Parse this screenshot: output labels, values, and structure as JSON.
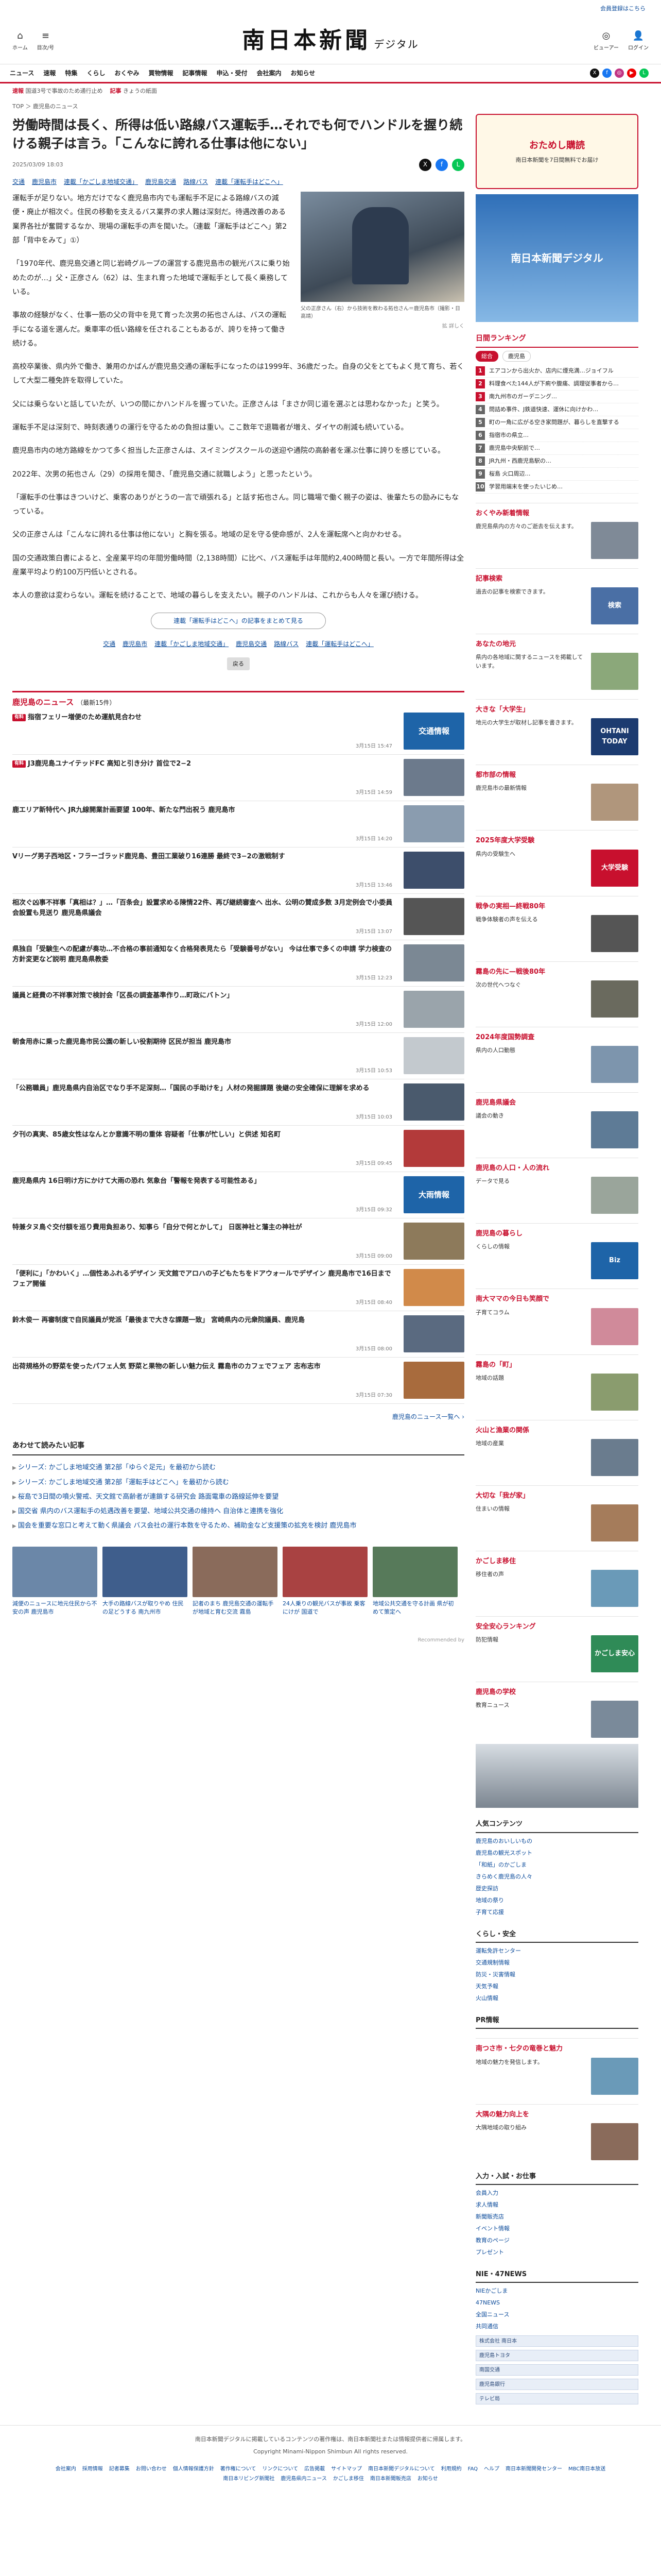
{
  "top": {
    "login": "会員登録はこちら"
  },
  "mast": {
    "left": [
      {
        "sym": "⌂",
        "label": "ホーム"
      },
      {
        "sym": "≡",
        "label": "目次/号"
      }
    ],
    "logo": "南日本新聞",
    "logo_sub": "デジタル",
    "right": [
      {
        "sym": "◎",
        "label": "ビューアー"
      },
      {
        "sym": "👤",
        "label": "ログイン"
      }
    ]
  },
  "nav": [
    "ニュース",
    "速報",
    "特集",
    "くらし",
    "おくやみ",
    "買物情報",
    "記事情報",
    "申込・受付",
    "会社案内",
    "お知らせ"
  ],
  "sns": [
    {
      "t": "X",
      "c": "#111"
    },
    {
      "t": "f",
      "c": "#1877f2"
    },
    {
      "t": "◎",
      "c": "#c13584"
    },
    {
      "t": "▶",
      "c": "#e00"
    },
    {
      "t": "L",
      "c": "#06c755"
    }
  ],
  "ticker": [
    {
      "tag": "速報",
      "text": "国道3号で事故のため通行止め"
    },
    {
      "tag": "記事",
      "text": "きょうの紙面"
    }
  ],
  "breadcrumb": "TOP ＞ 鹿児島のニュース",
  "article": {
    "title": "労働時間は長く、所得は低い路線バス運転手…それでも何でハンドルを握り続ける親子は言う。「こんなに誇れる仕事は他にない」",
    "date": "2025/03/09 18:03",
    "tags": [
      "交通",
      "鹿児島市",
      "連載「かごしま地域交通」",
      "鹿児島交通",
      "路線バス",
      "連載「運転手はどこへ」"
    ],
    "p1": "運転手が足りない。地方だけでなく鹿児島市内でも運転手不足による路線バスの減便・廃止が相次ぐ。住民の移動を支えるバス業界の求人難は深刻だ。待遇改善のある業界各社が奮闘するなか、現場の運転手の声を聞いた。（連載「運転手はどこへ」第2部「背中をみて」①）",
    "p2": "「1970年代、鹿児島交通と同じ岩崎グループの運営する鹿児島市の観光バスに乗り始めたのが…」父・正彦さん（62）は、生まれ育った地域で運転手として長く乗務している。",
    "p3": "事故の経験がなく、仕事一筋の父の背中を見て育った次男の拓也さんは、バスの運転手になる道を選んだ。乗車率の低い路線を任されることもあるが、誇りを持って働き続ける。",
    "p4": "高校卒業後、県内外で働き、兼用のかばんが鹿児島交通の運転手になったのは1999年、36歳だった。自身の父をとてもよく見て育ち、若くして大型二種免許を取得していた。",
    "p5": "父には乗らないと話していたが、いつの間にかハンドルを握っていた。正彦さんは「まさか同じ道を選ぶとは思わなかった」と笑う。",
    "p6": "運転手不足は深刻で、時刻表通りの運行を守るための負担は重い。ここ数年で退職者が増え、ダイヤの削減も続いている。",
    "p7": "鹿児島市内の地方路線をかつて多く担当した正彦さんは、スイミングスクールの送迎や通院の高齢者を運ぶ仕事に誇りを感じている。",
    "p8": "2022年、次男の拓也さん（29）の採用を聞き、「鹿児島交通に就職しよう」と思ったという。",
    "p9": "「運転手の仕事はきついけど、乗客のありがとうの一言で頑張れる」と話す拓也さん。同じ職場で働く親子の姿は、後輩たちの励みにもなっている。",
    "p10": "父の正彦さんは「こんなに誇れる仕事は他にない」と胸を張る。地域の足を守る使命感が、2人を運転席へと向かわせる。",
    "p11": "国の交通政策白書によると、全産業平均の年間労働時間（2,138時間）に比べ、バス運転手は年間約2,400時間と長い。一方で年間所得は全産業平均より約100万円低いとされる。",
    "p12": "本人の意欲は変わらない。運転を続けることで、地域の暮らしを支えたい。親子のハンドルは、これからも人々を運び続ける。",
    "photo_caption": "父の正彦さん（右）から技術を教わる拓也さん＝鹿児島市（撮影・日高靖）",
    "enlarge": "拡 詳しく",
    "series_button": "連載「運転手はどこへ」の記事をまとめて見る",
    "back": "戻る"
  },
  "news_list": {
    "heading": "鹿児島のニュース",
    "count": "（最新15件）",
    "items": [
      {
        "pay": "有料",
        "title": "指宿フェリー増便のため運航見合わせ",
        "time": "3月15日 15:47",
        "color": "#1e64a8",
        "thumb": "交通情報"
      },
      {
        "pay": "有料",
        "title": "J3鹿児島ユナイテッドFC 高知と引き分け 首位で2−2",
        "time": "3月15日 14:59",
        "color": "#6c7a8c",
        "thumb": ""
      },
      {
        "pay": "",
        "title": "鹿エリア新特代へ JR九線開業計画要望 100年、新たな門出祝う 鹿児島市",
        "time": "3月15日 14:20",
        "color": "#8a9caf",
        "thumb": ""
      },
      {
        "pay": "",
        "title": "Vリーグ男子西地区・フラーゴラッド鹿児島、豊田工業破り16連勝 最終で3−2の激戦制す",
        "time": "3月15日 13:46",
        "color": "#3d4e6b",
        "thumb": ""
      },
      {
        "pay": "",
        "title": "相次ぐ凶事不祥事「真相は？」…「百条会」設置求める陳情22件、再び継続審査へ 出水、公明の賛成多数 3月定例会で小委員会設置も見送り 鹿児島県議会",
        "time": "3月15日 13:07",
        "color": "#555",
        "thumb": ""
      },
      {
        "pay": "",
        "title": "県独自「受験生への配慮が奏功…不合格の事前通知なく合格発表見たら「受験番号がない」 今は仕事で多くの申請 学力検査の方針変更など説明 鹿児島県教委",
        "time": "3月15日 12:23",
        "color": "#7b8894",
        "thumb": ""
      },
      {
        "pay": "",
        "title": "議員と経費の不祥事対策で検討会「区長の調査基準作り…町政にバトン」",
        "time": "3月15日 12:00",
        "color": "#9aa4ab",
        "thumb": ""
      },
      {
        "pay": "",
        "title": "朝食用赤に乗った鹿児島市民公園の新しい役割期待 区民が担当 鹿児島市",
        "time": "3月15日 10:53",
        "color": "#c3c9ce",
        "thumb": ""
      },
      {
        "pay": "",
        "title": "「公務職員」鹿児島県内自治区でなり手不足深刻…「国民の手助けを」人材の発掘課題 後継の安全確保に理解を求める",
        "time": "3月15日 10:03",
        "color": "#4a5a6d",
        "thumb": ""
      },
      {
        "pay": "",
        "title": "夕刊の真実、85歳女性はなんとか意識不明の重体 容疑者「仕事が忙しい」と供述 知名町",
        "time": "3月15日 09:45",
        "color": "#b33a3a",
        "thumb": ""
      },
      {
        "pay": "",
        "title": "鹿児島県内 16日明け方にかけて大雨の恐れ 気象台「警報を発表する可能性ある」",
        "time": "3月15日 09:32",
        "color": "#1e64a8",
        "thumb": "大雨情報"
      },
      {
        "pay": "",
        "title": "特兼タヌ鳥ぐ交付額を巡り費用負担あり、知事ら「自分で何とかして」 日医神社と藩主の神社が",
        "time": "3月15日 09:00",
        "color": "#8d7a5b",
        "thumb": ""
      },
      {
        "pay": "",
        "title": "「便利に」「かわいく」…個性あふれるデザイン 天文館でアロハの子どもたちをドアウォールでデザイン 鹿児島市で16日までフェア開催",
        "time": "3月15日 08:40",
        "color": "#d18a4a",
        "thumb": ""
      },
      {
        "pay": "",
        "title": "鈴木俊一 再審制度で自民議員が党派「最後まで大きな課題一致」 宮崎県内の元衆院議員、鹿児島",
        "time": "3月15日 08:00",
        "color": "#5a6a80",
        "thumb": ""
      },
      {
        "pay": "",
        "title": "出荷規格外の野菜を使ったパフェ人気 野菜と果物の新しい魅力伝え 霧島市のカフェでフェア 志布志市",
        "time": "3月15日 07:30",
        "color": "#a86b3d",
        "thumb": ""
      }
    ],
    "more": "鹿児島のニュース一覧へ ›"
  },
  "picks": {
    "heading": "あわせて読みたい記事",
    "items": [
      "シリーズ: かごしま地域交通 第2部「ゆらぐ足元」を最初から読む",
      "シリーズ: かごしま地域交通 第2部「運転手はどこへ」を最初から読む",
      "桜島で3日間の噴火警戒、天文館で高齢者が連鎖する研究会 路面電車の路線延伸を要望",
      "国交省 県内のバス運転手の処遇改善を要望、地域公共交通の維持へ 自治体と連携を強化",
      "国会を重要な窓口と考えて動く県議会 バス会社の運行本数を守るため、補助金など支援策の拡充を検討 鹿児島市"
    ]
  },
  "recommend": [
    {
      "t": "減便のニュースに地元住民から不安の声 鹿児島市",
      "c": "#6b87a8"
    },
    {
      "t": "大手の路線バスが取りやめ 住民の足どうする 南九州市",
      "c": "#3f5e8c"
    },
    {
      "t": "記者のまち 鹿児島交通の運転手が地域と育む交流 霧島",
      "c": "#8a6b5b"
    },
    {
      "t": "24人乗りの観光バスが事故 乗客にけが 国道で",
      "c": "#a94242"
    },
    {
      "t": "地域公共交通を守る計画 県が初めて策定へ",
      "c": "#577a5a"
    }
  ],
  "ad": "Recommended by",
  "side": {
    "banner_top_1": "おためし購読",
    "banner_top_2": "南日本新聞を7日間無料でお届け",
    "banner_sq": "南日本新聞デジタル",
    "ranking_head": "日間ランキング",
    "rank_tabs": [
      "総合",
      "鹿児島"
    ],
    "ranking": [
      "エアコンから出火か、店内に煙充満…ジョイフル",
      "料理食べた144人が下痢や腹痛、調理従事者から…",
      "南九州市のガーデニング…",
      "問詰め事件、J鉄道快速、運休に向けかわ…",
      "町の一角に広がる空き家問題が、暮らしを直撃する",
      "指宿市の県立…",
      "鹿児島中央駅前で…",
      "JR九州・西鹿児島駅の…",
      "桜島 火口周辺…",
      "学習用端末を使ったいじめ…"
    ],
    "blocks": [
      {
        "title": "おくやみ新着情報",
        "text": "鹿児島県内の方々のご逝去を伝えます。",
        "img": "",
        "color": "#7f8a97"
      },
      {
        "title": "記事検索",
        "text": "過去の記事を検索できます。",
        "img": "検索",
        "color": "#4a6fa5"
      },
      {
        "title": "あなたの地元",
        "text": "県内の各地域に関するニュースを掲載しています。",
        "img": "",
        "color": "#8ba87a"
      },
      {
        "title": "大きな「大学生」",
        "text": "地元の大学生が取材し記事を書きます。",
        "img": "OHTANI TODAY",
        "color": "#1c3b70"
      },
      {
        "title": "都市部の情報",
        "text": "鹿児島市の最新情報",
        "img": "",
        "color": "#b0967c"
      },
      {
        "title": "2025年度大学受験",
        "text": "県内の受験生へ",
        "img": "大学受験",
        "color": "#c8102e"
      },
      {
        "title": "戦争の実相—終戦80年",
        "text": "戦争体験者の声を伝える",
        "img": "",
        "color": "#555"
      },
      {
        "title": "霧島の先に—戦後80年",
        "text": "次の世代へつなぐ",
        "img": "",
        "color": "#6a6a5e"
      },
      {
        "title": "2024年度国勢調査",
        "text": "県内の人口動態",
        "img": "",
        "color": "#7d95ad"
      },
      {
        "title": "鹿児島県議会",
        "text": "議会の動き",
        "img": "",
        "color": "#5e7b96"
      },
      {
        "title": "鹿児島の人口・人の流れ",
        "text": "データで見る",
        "img": "",
        "color": "#9aa59b"
      },
      {
        "title": "鹿児島の暮らし",
        "text": "くらしの情報",
        "img": "Biz",
        "color": "#1e64a8"
      },
      {
        "title": "南大ママの今日も笑顔で",
        "text": "子育てコラム",
        "img": "",
        "color": "#d08a9a"
      },
      {
        "title": "霧島の「町」",
        "text": "地域の話題",
        "img": "",
        "color": "#8a9c6e"
      },
      {
        "title": "火山と漁業の関係",
        "text": "地域の産業",
        "img": "",
        "color": "#6a7c8e"
      },
      {
        "title": "大切な「我が家」",
        "text": "住まいの情報",
        "img": "",
        "color": "#a57c5b"
      },
      {
        "title": "かごしま移住",
        "text": "移住者の声",
        "img": "",
        "color": "#6a9ab8"
      },
      {
        "title": "安全安心ランキング",
        "text": "防犯情報",
        "img": "かごしま安心",
        "color": "#2f8b57"
      },
      {
        "title": "鹿児島の学校",
        "text": "教育ニュース",
        "img": "",
        "color": "#7a8a9a"
      }
    ],
    "people_head": "人気コンテンツ",
    "people_list": [
      "鹿児島のおいしいもの",
      "鹿児島の観光スポット",
      "「和紙」のかごしま",
      "きらめく鹿児島の人々",
      "歴史探訪",
      "地域の祭り",
      "子育て応援"
    ],
    "life_head": "くらし・安全",
    "life_list": [
      "運転免許センター",
      "交通規制情報",
      "防災・災害情報",
      "天気予報",
      "火山情報"
    ],
    "pr_head": "PR情報",
    "pr_items": [
      {
        "title": "南つさ市・七夕の竜巻と魅力",
        "text": "地域の魅力を発信します。",
        "color": "#6a9ab8"
      },
      {
        "title": "大隅の魅力向上を",
        "text": "大隅地域の取り組み",
        "color": "#8a6b5b"
      }
    ],
    "input_head": "入力・入試・お仕事",
    "input_list": [
      "会員入力",
      "求人情報",
      "新聞販売店",
      "イベント情報",
      "教育のページ",
      "プレゼント"
    ],
    "nie_head": "NIE・47NEWS",
    "nie_list": [
      "NIEかごしま",
      "47NEWS",
      "全国ニュース",
      "共同通信"
    ],
    "mini_ads": [
      "株式会社 南日本",
      "鹿児島トヨタ",
      "南国交通",
      "鹿児島銀行",
      "テレビ局"
    ]
  },
  "footer": {
    "text": "南日本新聞デジタルに掲載しているコンテンツの著作権は、南日本新聞社または情報提供者に帰属します。",
    "copy": "Copyright Minami-Nippon Shimbun All rights reserved.",
    "links": [
      "会社案内",
      "採用情報",
      "記者募集",
      "お問い合わせ",
      "個人情報保護方針",
      "著作権について",
      "リンクについて",
      "広告掲載",
      "サイトマップ",
      "南日本新聞デジタルについて",
      "利用規約",
      "FAQ",
      "ヘルプ",
      "南日本新聞開発センター",
      "MBC南日本放送",
      "南日本リビング新聞社",
      "鹿児島県内ニュース",
      "かごしま移住",
      "南日本新聞販売店",
      "お知らせ"
    ]
  }
}
